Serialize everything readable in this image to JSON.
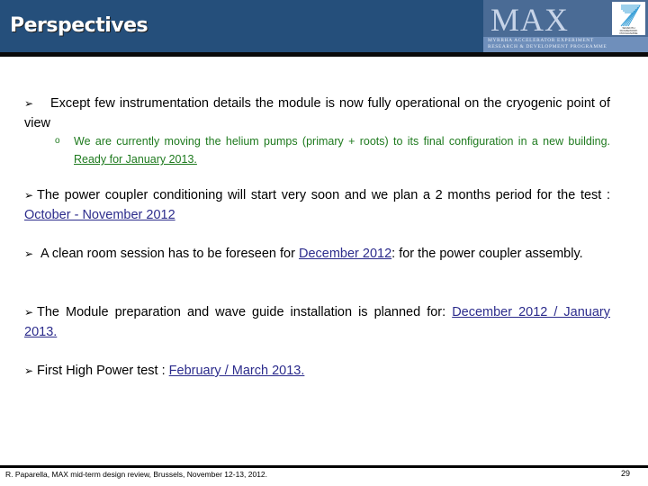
{
  "header": {
    "title": "Perspectives",
    "logo_text": "MAX",
    "logo_subtitle_line1": "MYRRHA Accelerator eXperiment",
    "logo_subtitle_line2": "Research & development programme",
    "fp7_text": "SEVENTH FRAMEWORK PROGRAMME"
  },
  "bullets": [
    {
      "text": "Except few instrumentation details the module is now fully operational on the cryogenic point of view",
      "sub": {
        "text": "We are currently moving the helium pumps (primary + roots) to its final configuration in a new building. ",
        "highlight": "Ready for January 2013."
      }
    },
    {
      "text": "The power coupler conditioning  will start very soon and we plan a 2 months period for the test : ",
      "link": "October - November 2012"
    },
    {
      "text": "A clean room session has to be foreseen for ",
      "link": "December 2012",
      "after": ": for the power coupler assembly."
    },
    {
      "text": "The Module preparation and wave guide installation is planned for: ",
      "link": "December 2012 / January 2013."
    },
    {
      "text": "First High Power test : ",
      "link": "February / March 2013."
    }
  ],
  "icons": {
    "arrow": "➢",
    "sub_bullet": "o"
  },
  "footer": {
    "text": "R. Paparella, MAX mid-term design review, Brussels, November 12-13, 2012.",
    "page_number": "29"
  },
  "colors": {
    "header_bg": "#254f7b",
    "link": "#2c2c8c",
    "sub_text": "#1e7a1e"
  }
}
